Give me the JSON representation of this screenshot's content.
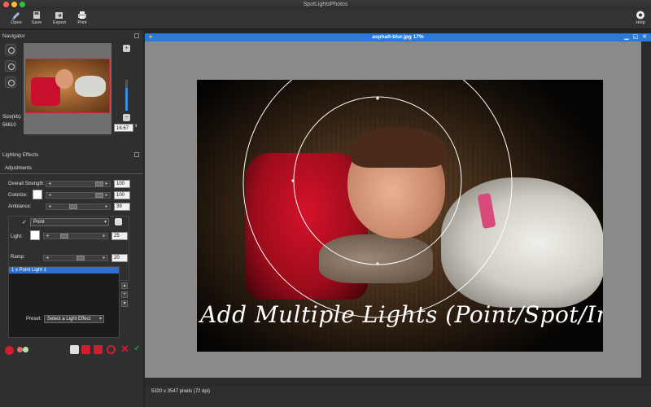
{
  "window": {
    "title": "SpotLightsPhotos"
  },
  "toolbar": {
    "open_label": "Open",
    "save_label": "Save",
    "export_label": "Export",
    "print_label": "Print",
    "help_label": "Help"
  },
  "navigator": {
    "title": "Navigator",
    "size_label": "Size(kb):",
    "size_value": "56610",
    "zoom_value": "16.67",
    "zoom_fill_fraction": 0.75
  },
  "lighting": {
    "title": "Lighting Effects",
    "tab_label": "Adjustments",
    "overall_strength_label": "Overall Strength:",
    "overall_strength_value": "100",
    "colorize_label": "Colorize:",
    "colorize_value": "100",
    "ambiance_label": "Ambiance:",
    "ambiance_value": "39",
    "light_type": "Point",
    "light_label": "Light:",
    "light_value": "25",
    "ramp_label": "Ramp:",
    "ramp_value": "20",
    "lights_list": [
      "1   x Point Light 1"
    ],
    "preset_label": "Preset:",
    "preset_value": "Select a Light Effect"
  },
  "image_window": {
    "title": "asphalt-blur.jpg 17%",
    "caption": "Add Multiple Lights (Point/Spot/Infinite...)",
    "status": "5320 x 3547 pixels (72 dpi)"
  },
  "colors": {
    "accent": "#2b7ad7",
    "panel": "#2f2f2f",
    "canvas": "#8a8a8a"
  }
}
